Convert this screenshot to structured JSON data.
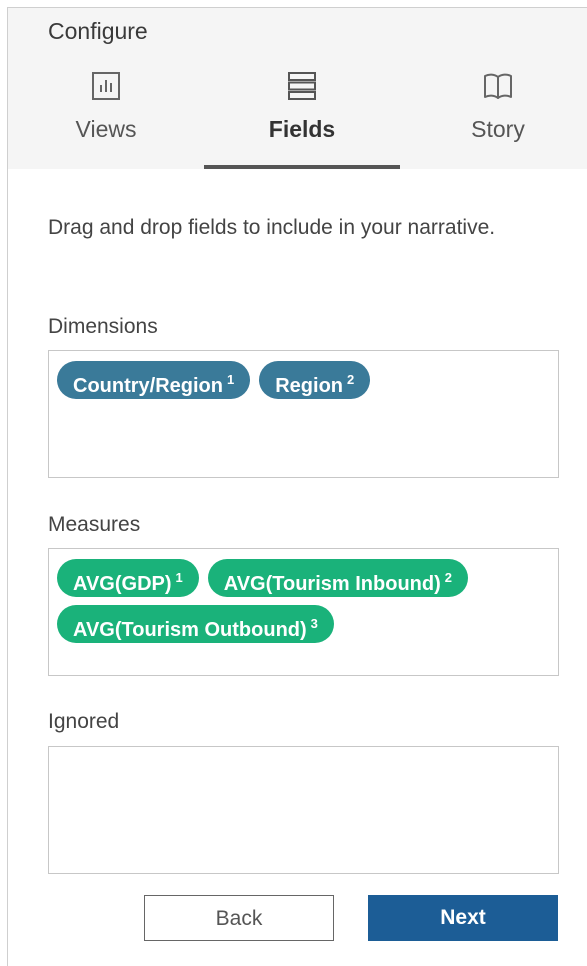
{
  "header": {
    "title": "Configure",
    "tabs": [
      {
        "label": "Views",
        "icon": "bar-chart-icon"
      },
      {
        "label": "Fields",
        "icon": "list-icon"
      },
      {
        "label": "Story",
        "icon": "book-icon"
      }
    ],
    "active_tab": "Fields"
  },
  "instructions": "Drag and drop fields to include in your narrative.",
  "dimensions": {
    "label": "Dimensions",
    "pills": [
      {
        "label": "Country/Region",
        "order": "1"
      },
      {
        "label": "Region",
        "order": "2"
      }
    ]
  },
  "measures": {
    "label": "Measures",
    "pills": [
      {
        "label": "AVG(GDP)",
        "order": "1"
      },
      {
        "label": "AVG(Tourism Inbound)",
        "order": "2"
      },
      {
        "label": "AVG(Tourism Outbound)",
        "order": "3"
      }
    ]
  },
  "ignored": {
    "label": "Ignored",
    "pills": []
  },
  "buttons": {
    "back": "Back",
    "next": "Next"
  },
  "colors": {
    "dimension_pill": "#3a7a99",
    "measure_pill": "#1ab27a",
    "primary_button": "#1c5d96"
  }
}
